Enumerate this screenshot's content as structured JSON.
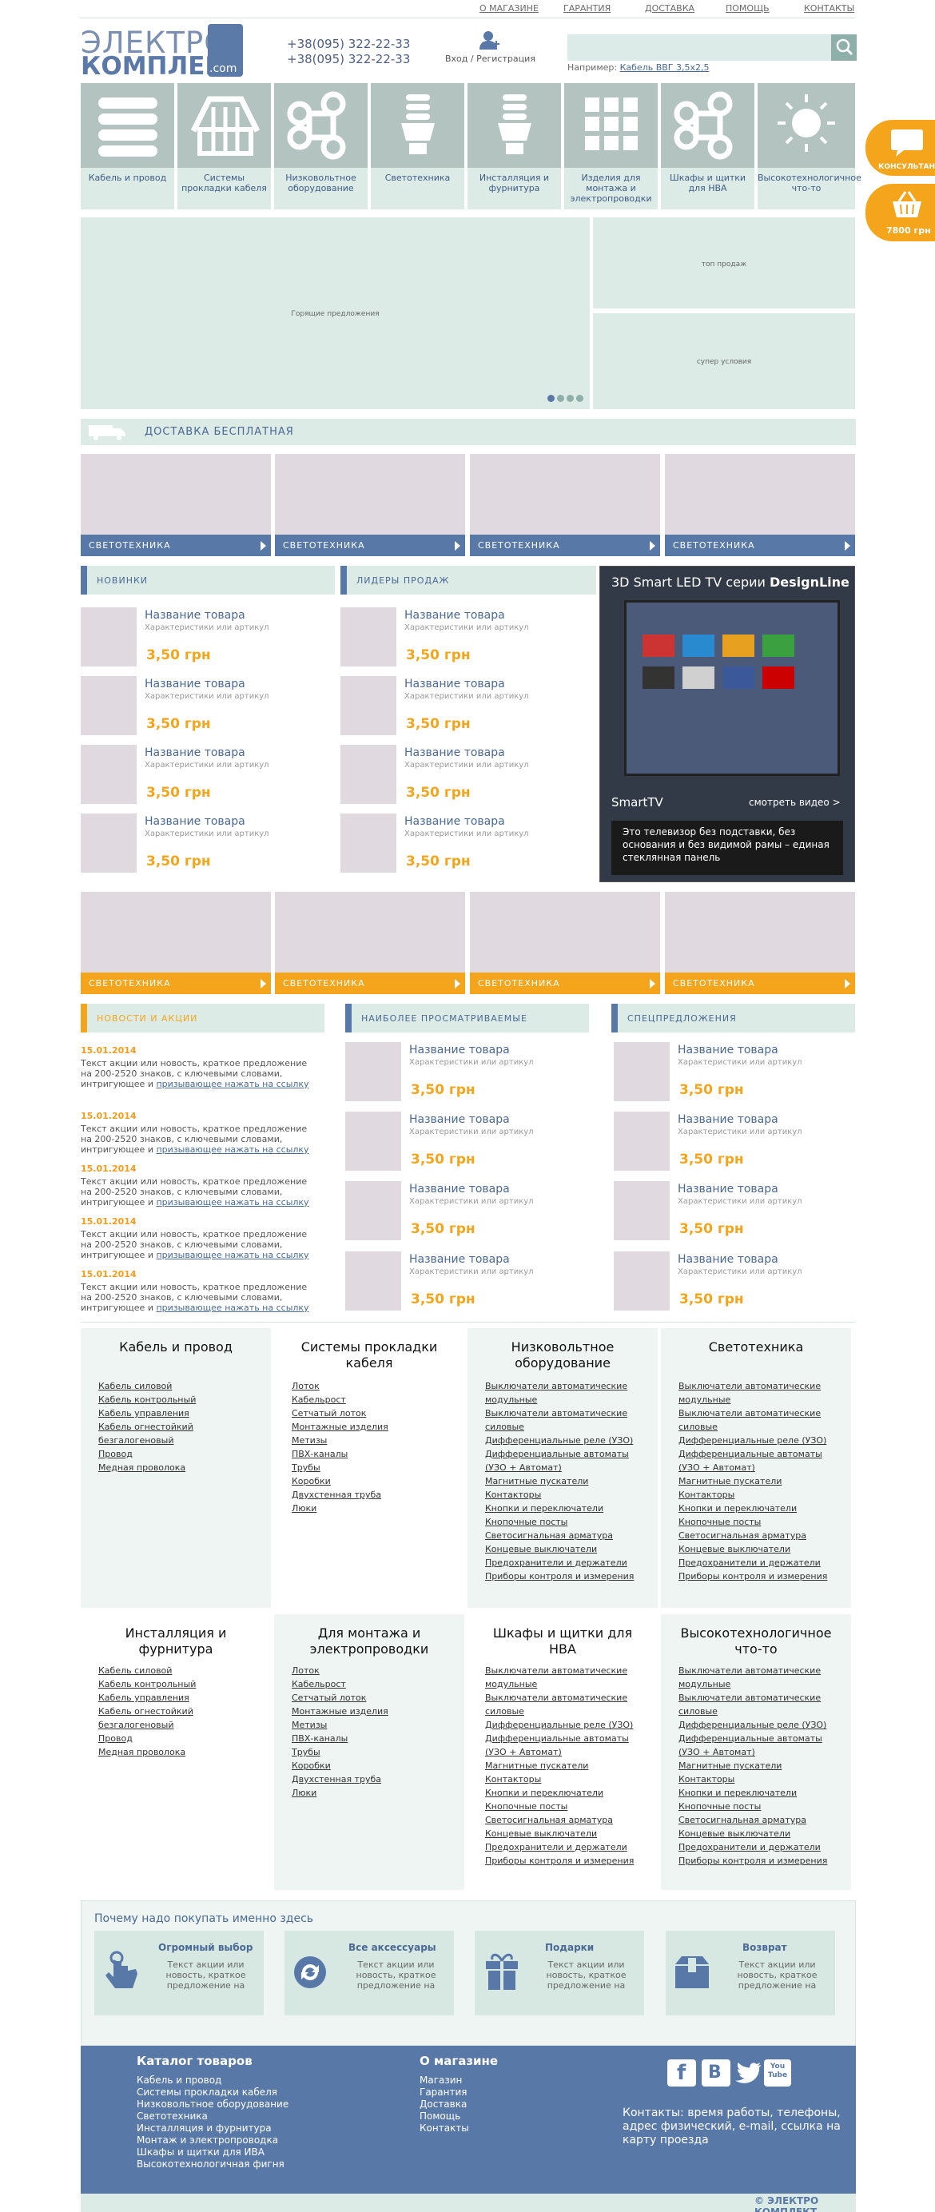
{
  "topnav": [
    "О МАГАЗИНЕ",
    "ГАРАНТИЯ",
    "ДОСТАВКА",
    "ПОМОЩЬ",
    "КОНТАКТЫ"
  ],
  "logo": {
    "line1": "ЭЛЕКТРО",
    "line2": "КОМПЛЕКТ",
    "com": ".com"
  },
  "phones": [
    "+38(095) 322-22-33",
    "+38(095) 322-22-33"
  ],
  "login": "Вход / Регистрация",
  "search": {
    "placeholder": "",
    "hint": "Например:",
    "hint_link": "Кабель ВВГ 3,5х2,5"
  },
  "categories": [
    "Кабель и провод",
    "Системы прокладки кабеля",
    "Низковольтное оборудование",
    "Светотехника",
    "Инсталляция и фурнитура",
    "Изделия для монтажа и электропроводки",
    "Шкафы и щитки для НВА",
    "Высокотехнологичное что-то"
  ],
  "side": {
    "consult": "КОНСУЛЬТАНТ",
    "cart": "7800 грн"
  },
  "banners": {
    "hot": "Горящие предложения",
    "top": "топ продаж",
    "super": "супер условия"
  },
  "delivery": "ДОСТАВКА  БЕСПЛАТНАЯ",
  "tiles": [
    "СВЕТОТЕХНИКА",
    "СВЕТОТЕХНИКА",
    "СВЕТОТЕХНИКА",
    "СВЕТОТЕХНИКА"
  ],
  "tiles2": [
    "СВЕТОТЕХНИКА",
    "СВЕТОТЕХНИКА",
    "СВЕТОТЕХНИКА",
    "СВЕТОТЕХНИКА"
  ],
  "sections": {
    "new": "НОВИНКИ",
    "leaders": "ЛИДЕРЫ ПРОДАЖ",
    "news": "НОВОСТИ И АКЦИИ",
    "viewed": "НАИБОЛЕЕ ПРОСМАТРИВАЕМЫЕ",
    "special": "СПЕЦПРЕДЛОЖЕНИЯ"
  },
  "product": {
    "name": "Название товара",
    "chars": "Характеристики или артикул",
    "price": "3,50 грн"
  },
  "tv": {
    "title_a": "3D Smart LED TV серии ",
    "title_b": "DesignLine",
    "smart": "SmartTV",
    "video": "смотреть видео >",
    "text": "Это телевизор без подставки, без основания и без видимой рамы – единая стеклянная панель"
  },
  "news": {
    "date": "15.01.2014",
    "text": "Текст акции или новость, краткое предложение на 200-2520 знаков, с ключевыми словами, интригующее и ",
    "link": "призывающее нажать на ссылку"
  },
  "bigcats": [
    {
      "title": "Кабель и провод",
      "items": [
        "Кабель силовой",
        "Кабель контрольный",
        "Кабель управления",
        "Кабель огнестойкий безгалогеновый",
        "Провод",
        "Медная проволока"
      ]
    },
    {
      "title": "Системы прокладки кабеля",
      "items": [
        "Лоток",
        "Кабельрост",
        "Сетчатый лоток",
        "Монтажные изделия",
        "Метизы",
        "ПВХ-каналы",
        "Трубы",
        "Коробки",
        "Двухстенная труба",
        "Люки"
      ]
    },
    {
      "title": "Низковольтное оборудование",
      "items": [
        "Выключатели автоматические модульные",
        "Выключатели автоматические силовые",
        "Дифференциальные реле (УЗО)",
        "Дифференциальные автоматы (УЗО + Автомат)",
        "Магнитные пускатели",
        "Контакторы",
        "Кнопки и переключатели",
        "Кнопочные посты",
        "Светосигнальная арматура",
        "Концевые выключатели",
        "Предохранители и держатели",
        "Приборы контроля и измерения"
      ]
    },
    {
      "title": "Светотехника",
      "items": [
        "Выключатели автоматические модульные",
        "Выключатели автоматические силовые",
        "Дифференциальные реле (УЗО)",
        "Дифференциальные автоматы (УЗО + Автомат)",
        "Магнитные пускатели",
        "Контакторы",
        "Кнопки и переключатели",
        "Кнопочные посты",
        "Светосигнальная арматура",
        "Концевые выключатели",
        "Предохранители и держатели",
        "Приборы контроля и измерения"
      ]
    },
    {
      "title": "Инсталляция и фурнитура",
      "items": [
        "Кабель силовой",
        "Кабель контрольный",
        "Кабель управления",
        "Кабель огнестойкий безгалогеновый",
        "Провод",
        "Медная проволока"
      ]
    },
    {
      "title": "Для монтажа и электропроводки",
      "items": [
        "Лоток",
        "Кабельрост",
        "Сетчатый лоток",
        "Монтажные изделия",
        "Метизы",
        "ПВХ-каналы",
        "Трубы",
        "Коробки",
        "Двухстенная труба",
        "Люки"
      ]
    },
    {
      "title": "Шкафы и щитки для НВА",
      "items": [
        "Выключатели автоматические модульные",
        "Выключатели автоматические силовые",
        "Дифференциальные реле (УЗО)",
        "Дифференциальные автоматы (УЗО + Автомат)",
        "Магнитные пускатели",
        "Контакторы",
        "Кнопки и переключатели",
        "Кнопочные посты",
        "Светосигнальная арматура",
        "Концевые выключатели",
        "Предохранители и держатели",
        "Приборы контроля и измерения"
      ]
    },
    {
      "title": "Высокотехнологичное что-то",
      "items": [
        "Выключатели автоматические модульные",
        "Выключатели автоматические силовые",
        "Дифференциальные реле (УЗО)",
        "Дифференциальные автоматы (УЗО + Автомат)",
        "Магнитные пускатели",
        "Контакторы",
        "Кнопки и переключатели",
        "Кнопочные посты",
        "Светосигнальная арматура",
        "Концевые выключатели",
        "Предохранители и держатели",
        "Приборы контроля и измерения"
      ]
    }
  ],
  "why": {
    "title": "Почему надо покупать именно здесь",
    "boxes": [
      {
        "title": "Огромный выбор",
        "text": "Текст акции или новость, краткое предложение на"
      },
      {
        "title": "Все аксессуары",
        "text": "Текст акции или новость, краткое предложение на"
      },
      {
        "title": "Подарки",
        "text": "Текст акции или новость, краткое предложение на"
      },
      {
        "title": "Возврат",
        "text": "Текст акции или новость, краткое предложение на"
      }
    ]
  },
  "footer": {
    "catalog_title": "Каталог товаров",
    "catalog": [
      "Кабель и провод",
      "Системы прокладки кабеля",
      "Низковольтное оборудование",
      "Светотехника",
      "Инсталляция и фурнитура",
      "Монтаж и электропроводка",
      "Шкафы и щитки для ИВА",
      "Высокотехнологичная фигня"
    ],
    "about_title": "О магазине",
    "about": [
      "Магазин",
      "Гарантия",
      "Доставка",
      "Помощь",
      "Контакты"
    ],
    "contacts": "Контакты: время работы, телефоны, адрес физический, e-mail, ссылка на карту проезда",
    "social": [
      "f",
      "В",
      "t",
      "You Tube"
    ],
    "copy": "© ЭЛЕКТРО КОМПЛЕКТ"
  },
  "colors": {
    "accent": "#f5a51c",
    "blue": "#5878a8",
    "mint": "#dcebe6",
    "tile": "#e0d9e0"
  }
}
